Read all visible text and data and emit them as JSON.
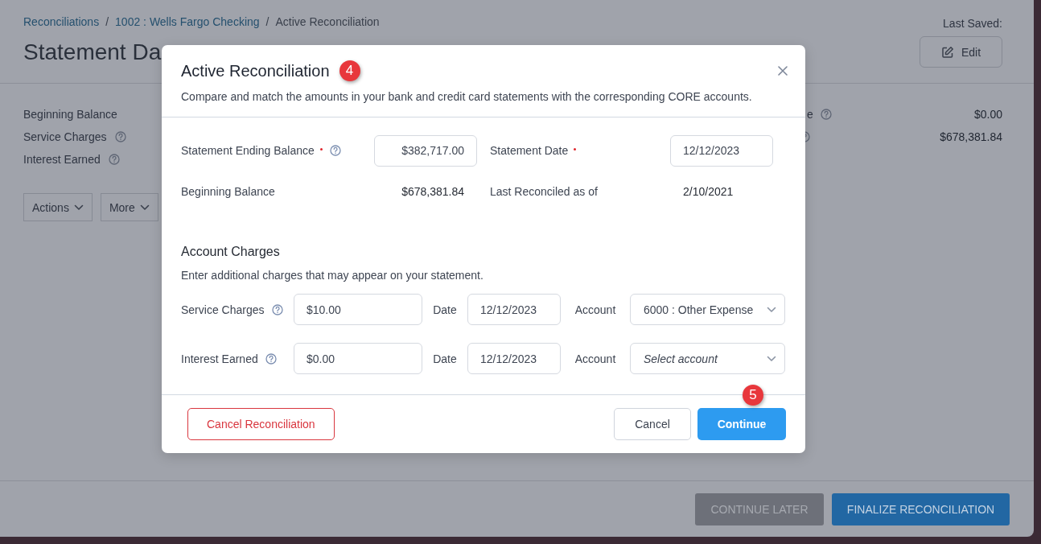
{
  "breadcrumbs": [
    {
      "kind": "link",
      "label": "Reconciliations"
    },
    {
      "kind": "separator",
      "label": "/"
    },
    {
      "kind": "link",
      "label": "1002 : Wells Fargo Checking"
    },
    {
      "kind": "separator",
      "label": "/"
    },
    {
      "kind": "current",
      "label": "Active Reconciliation"
    }
  ],
  "page_title": "Statement Da",
  "last_saved": "Last Saved:",
  "edit_button": "Edit",
  "summary_left": [
    {
      "label": "Beginning Balance",
      "help": false
    },
    {
      "label": "Service Charges",
      "help": true
    },
    {
      "label": "Interest Earned",
      "help": true
    }
  ],
  "summary_right": [
    {
      "label": "e",
      "help": true,
      "value": "$0.00"
    },
    {
      "help": true,
      "value": "$678,381.84"
    }
  ],
  "toolbar": [
    {
      "label": "Actions"
    },
    {
      "label": "More"
    }
  ],
  "footer_buttons": [
    {
      "label": "CONTINUE LATER",
      "kind": "secondary"
    },
    {
      "label": "FINALIZE RECONCILIATION",
      "kind": "primary"
    }
  ],
  "dialog": {
    "title": "Active Reconciliation",
    "title_badge": "4",
    "description": "Compare and match the amounts in your bank and credit card statements with the corresponding CORE accounts.",
    "fields": [
      {
        "kind": "input",
        "label": "Statement Ending Balance",
        "required": true,
        "help": true,
        "value": "$382,717.00"
      },
      {
        "kind": "input",
        "label": "Statement Date",
        "required": true,
        "help": false,
        "value": "12/12/2023"
      },
      {
        "kind": "readout",
        "label": "Beginning Balance",
        "required": false,
        "help": false,
        "value": "$678,381.84"
      },
      {
        "kind": "readout",
        "label": "Last Reconciled as of",
        "required": false,
        "help": false,
        "value": "2/10/2021"
      }
    ],
    "section_title": "Account Charges",
    "section_description": "Enter additional charges that may appear on your statement.",
    "charges": [
      {
        "label": "Service Charges",
        "help": true,
        "amount": "$10.00",
        "date_label": "Date",
        "date": "12/12/2023",
        "account_label": "Account",
        "account": "6000 : Other Expense"
      },
      {
        "label": "Interest Earned",
        "help": true,
        "amount": "$0.00",
        "date_label": "Date",
        "date": "12/12/2023",
        "account_label": "Account",
        "account_placeholder": "Select account"
      }
    ],
    "buttons": [
      {
        "label": "Cancel Reconciliation",
        "kind": "danger"
      },
      {
        "label": "Cancel",
        "kind": "default"
      },
      {
        "label": "Continue",
        "kind": "primary",
        "badge": "5"
      }
    ]
  }
}
